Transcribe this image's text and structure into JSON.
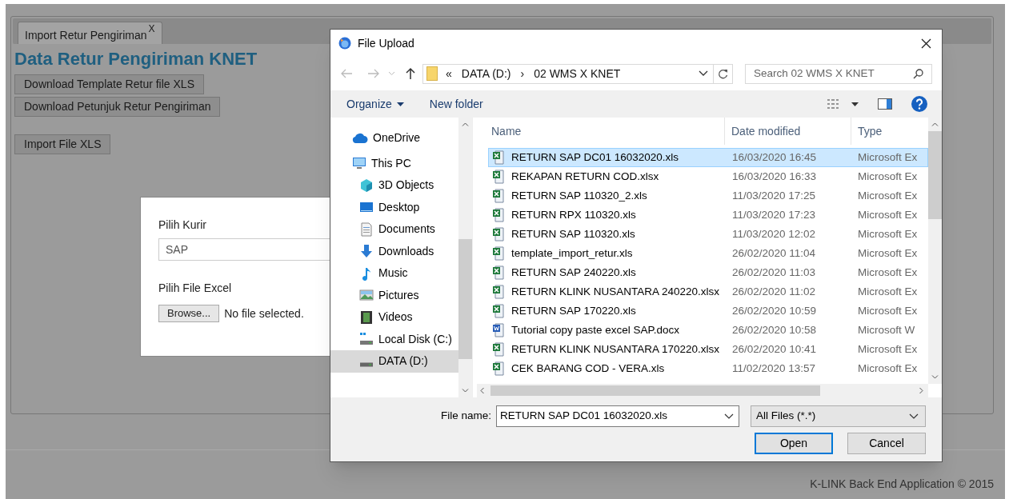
{
  "page": {
    "tab": {
      "label": "Import Retur Pengiriman",
      "close": "X",
      "selected": true
    },
    "heading": "Data Retur Pengiriman KNET",
    "buttons": [
      "Download Template Retur file XLS",
      "Download Petunjuk Retur Pengiriman"
    ],
    "import_button": "Import File XLS",
    "footer": "K-LINK Back End Application © 2015"
  },
  "modal": {
    "courier_label": "Pilih Kurir",
    "courier_value": "SAP",
    "file_label": "Pilih File Excel",
    "browse_button": "Browse...",
    "file_status": "No file selected."
  },
  "dialog": {
    "title": "File Upload",
    "path": [
      {
        "label": "«"
      },
      {
        "label": "DATA (D:)"
      },
      {
        "label": "›"
      },
      {
        "label": "02 WMS X KNET"
      }
    ],
    "search": {
      "placeholder": "Search 02 WMS X KNET"
    },
    "toolbar": {
      "organize": "Organize",
      "new_folder": "New folder"
    },
    "nav": [
      {
        "label": "OneDrive",
        "kind": "cloud",
        "selected": false
      },
      {
        "label": "This PC",
        "kind": "pc",
        "selected": false,
        "children": [
          {
            "label": "3D Objects",
            "kind": "cube",
            "selected": false
          },
          {
            "label": "Desktop",
            "kind": "desktop",
            "selected": false
          },
          {
            "label": "Documents",
            "kind": "document",
            "selected": false
          },
          {
            "label": "Downloads",
            "kind": "download",
            "selected": false
          },
          {
            "label": "Music",
            "kind": "music",
            "selected": false
          },
          {
            "label": "Pictures",
            "kind": "pictures",
            "selected": false
          },
          {
            "label": "Videos",
            "kind": "videos",
            "selected": false
          },
          {
            "label": "Local Disk (C:)",
            "kind": "disk",
            "selected": false
          },
          {
            "label": "DATA (D:)",
            "kind": "drive",
            "selected": true
          }
        ]
      }
    ],
    "columns": [
      "Name",
      "Date modified",
      "Type"
    ],
    "files": [
      {
        "name": "RETURN SAP DC01 16032020.xls",
        "date": "16/03/2020 16:45",
        "type": "Microsoft Ex",
        "kind": "excel",
        "selected": true
      },
      {
        "name": "REKAPAN RETURN COD.xlsx",
        "date": "16/03/2020 16:33",
        "type": "Microsoft Ex",
        "kind": "excel",
        "selected": false
      },
      {
        "name": "RETURN SAP 110320_2.xls",
        "date": "11/03/2020 17:25",
        "type": "Microsoft Ex",
        "kind": "excel",
        "selected": false
      },
      {
        "name": "RETURN RPX 110320.xls",
        "date": "11/03/2020 17:23",
        "type": "Microsoft Ex",
        "kind": "excel",
        "selected": false
      },
      {
        "name": "RETURN SAP 110320.xls",
        "date": "11/03/2020 12:02",
        "type": "Microsoft Ex",
        "kind": "excel",
        "selected": false
      },
      {
        "name": "template_import_retur.xls",
        "date": "26/02/2020 11:04",
        "type": "Microsoft Ex",
        "kind": "excel",
        "selected": false
      },
      {
        "name": "RETURN SAP 240220.xls",
        "date": "26/02/2020 11:03",
        "type": "Microsoft Ex",
        "kind": "excel",
        "selected": false
      },
      {
        "name": "RETURN KLINK NUSANTARA 240220.xlsx",
        "date": "26/02/2020 11:02",
        "type": "Microsoft Ex",
        "kind": "excel",
        "selected": false
      },
      {
        "name": "RETURN SAP 170220.xls",
        "date": "26/02/2020 10:59",
        "type": "Microsoft Ex",
        "kind": "excel",
        "selected": false
      },
      {
        "name": "Tutorial copy paste excel SAP.docx",
        "date": "26/02/2020 10:58",
        "type": "Microsoft W",
        "kind": "word",
        "selected": false
      },
      {
        "name": "RETURN KLINK NUSANTARA 170220.xlsx",
        "date": "26/02/2020 10:41",
        "type": "Microsoft Ex",
        "kind": "excel",
        "selected": false
      },
      {
        "name": "CEK BARANG COD - VERA.xls",
        "date": "11/02/2020 13:57",
        "type": "Microsoft Ex",
        "kind": "excel",
        "selected": false
      }
    ],
    "file_name_label": "File name:",
    "file_name": "RETURN SAP DC01 16032020.xls",
    "filter": "All Files (*.*)",
    "open": "Open",
    "cancel": "Cancel"
  }
}
